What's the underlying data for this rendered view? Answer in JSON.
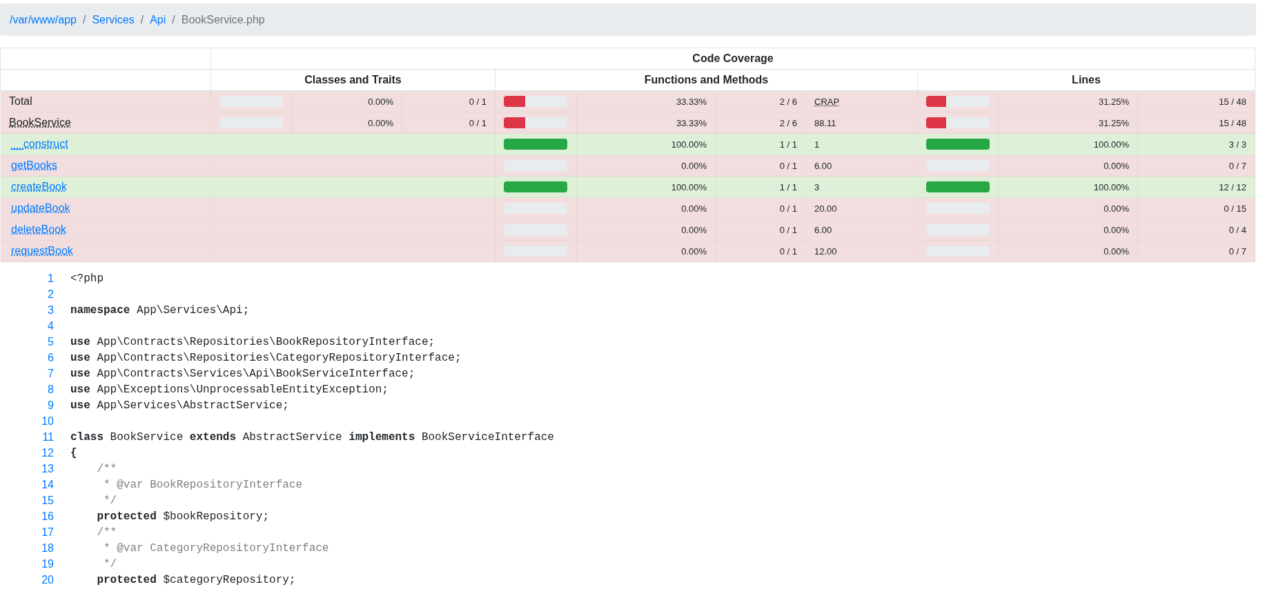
{
  "breadcrumb": [
    {
      "kind": "link",
      "label": "/var/www/app"
    },
    {
      "kind": "separator",
      "label": "/"
    },
    {
      "kind": "link",
      "label": "Services"
    },
    {
      "kind": "separator",
      "label": "/"
    },
    {
      "kind": "link",
      "label": "Api"
    },
    {
      "kind": "separator",
      "label": "/"
    },
    {
      "kind": "current",
      "label": "BookService.php"
    }
  ],
  "coverage_table": {
    "title": "Code Coverage",
    "groups": [
      "Classes and Traits",
      "Functions and Methods",
      "Lines"
    ],
    "rows": [
      {
        "kind": "total",
        "name": "Total",
        "covered": false,
        "classes": {
          "level": 0,
          "percent": "0.00%",
          "count": "0 / 1"
        },
        "functions": {
          "level": 0.3333,
          "percent": "33.33%",
          "count": "2 / 6"
        },
        "crap": "CRAP",
        "lines": {
          "level": 0.3125,
          "percent": "31.25%",
          "count": "15 / 48"
        }
      },
      {
        "kind": "class",
        "name": "BookService",
        "covered": false,
        "classes": {
          "level": 0,
          "percent": "0.00%",
          "count": "0 / 1"
        },
        "functions": {
          "level": 0.3333,
          "percent": "33.33%",
          "count": "2 / 6"
        },
        "crap": "88.11",
        "lines": {
          "level": 0.3125,
          "percent": "31.25%",
          "count": "15 / 48"
        }
      },
      {
        "kind": "method",
        "name": "__construct",
        "covered": true,
        "functions": {
          "level": 1,
          "percent": "100.00%",
          "count": "1 / 1"
        },
        "crap": "1",
        "lines": {
          "level": 1,
          "percent": "100.00%",
          "count": "3 / 3"
        }
      },
      {
        "kind": "method",
        "name": "getBooks",
        "covered": false,
        "functions": {
          "level": 0,
          "percent": "0.00%",
          "count": "0 / 1"
        },
        "crap": "6.00",
        "lines": {
          "level": 0,
          "percent": "0.00%",
          "count": "0 / 7"
        }
      },
      {
        "kind": "method",
        "name": "createBook",
        "covered": true,
        "functions": {
          "level": 1,
          "percent": "100.00%",
          "count": "1 / 1"
        },
        "crap": "3",
        "lines": {
          "level": 1,
          "percent": "100.00%",
          "count": "12 / 12"
        }
      },
      {
        "kind": "method",
        "name": "updateBook",
        "covered": false,
        "functions": {
          "level": 0,
          "percent": "0.00%",
          "count": "0 / 1"
        },
        "crap": "20.00",
        "lines": {
          "level": 0,
          "percent": "0.00%",
          "count": "0 / 15"
        }
      },
      {
        "kind": "method",
        "name": "deleteBook",
        "covered": false,
        "functions": {
          "level": 0,
          "percent": "0.00%",
          "count": "0 / 1"
        },
        "crap": "6.00",
        "lines": {
          "level": 0,
          "percent": "0.00%",
          "count": "0 / 4"
        }
      },
      {
        "kind": "method",
        "name": "requestBook",
        "covered": false,
        "functions": {
          "level": 0,
          "percent": "0.00%",
          "count": "0 / 1"
        },
        "crap": "12.00",
        "lines": {
          "level": 0,
          "percent": "0.00%",
          "count": "0 / 7"
        }
      }
    ]
  },
  "source": [
    {
      "number": "1",
      "kind": "code",
      "text": "<?php"
    },
    {
      "number": "2",
      "kind": "blank"
    },
    {
      "number": "3",
      "kind": "code",
      "text": "**namespace** App\\Services\\Api;"
    },
    {
      "number": "4",
      "kind": "blank"
    },
    {
      "number": "5",
      "kind": "code",
      "text": "**use** App\\Contracts\\Repositories\\BookRepositoryInterface;"
    },
    {
      "number": "6",
      "kind": "code",
      "text": "**use** App\\Contracts\\Repositories\\CategoryRepositoryInterface;"
    },
    {
      "number": "7",
      "kind": "code",
      "text": "**use** App\\Contracts\\Services\\Api\\BookServiceInterface;"
    },
    {
      "number": "8",
      "kind": "code",
      "text": "**use** App\\Exceptions\\UnprocessableEntityException;"
    },
    {
      "number": "9",
      "kind": "code",
      "text": "**use** App\\Services\\AbstractService;"
    },
    {
      "number": "10",
      "kind": "blank"
    },
    {
      "number": "11",
      "kind": "code",
      "text": "**class** BookService **extends** AbstractService **implements** BookServiceInterface"
    },
    {
      "number": "12",
      "kind": "keyword",
      "text": "{"
    },
    {
      "number": "13",
      "kind": "comment",
      "text": "    /**"
    },
    {
      "number": "14",
      "kind": "comment",
      "text": "     * @var BookRepositoryInterface"
    },
    {
      "number": "15",
      "kind": "comment",
      "text": "     */"
    },
    {
      "number": "16",
      "kind": "code",
      "text": "    **protected** $bookRepository;"
    },
    {
      "number": "17",
      "kind": "comment",
      "text": "    /**"
    },
    {
      "number": "18",
      "kind": "comment",
      "text": "     * @var CategoryRepositoryInterface"
    },
    {
      "number": "19",
      "kind": "comment",
      "text": "     */"
    },
    {
      "number": "20",
      "kind": "code",
      "text": "    **protected** $categoryRepository;"
    }
  ]
}
